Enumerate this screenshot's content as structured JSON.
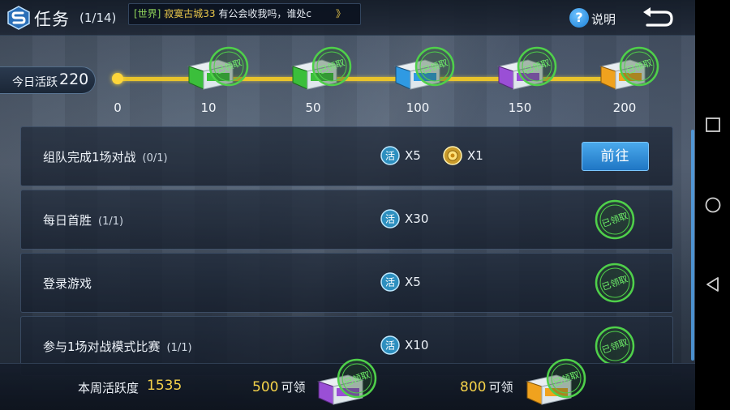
{
  "header": {
    "title": "任务",
    "count": "(1/14)",
    "chat": {
      "channel": "[世界]",
      "name": "寂寞古城33",
      "message": "有公会收我吗，谁处c",
      "arrow": "》"
    },
    "help_icon": "?",
    "help_label": "说明"
  },
  "activity": {
    "today_label": "今日活跃",
    "today_value": "220",
    "milestones": [
      {
        "value": "0"
      },
      {
        "value": "10",
        "chest": "green",
        "stamp": "已领取"
      },
      {
        "value": "50",
        "chest": "green",
        "stamp": "已领取"
      },
      {
        "value": "100",
        "chest": "blue",
        "stamp": "已领取"
      },
      {
        "value": "150",
        "chest": "purple",
        "stamp": "已领取"
      },
      {
        "value": "200",
        "chest": "orange",
        "stamp": "已领取"
      }
    ]
  },
  "tasks": [
    {
      "name": "组队完成1场对战",
      "progress": "(0/1)",
      "rewards": [
        {
          "icon": "huo-icon",
          "count": "X5"
        },
        {
          "icon": "sun-coin-icon",
          "count": "X1"
        }
      ],
      "action": "前往"
    },
    {
      "name": "每日首胜",
      "progress": "(1/1)",
      "rewards": [
        {
          "icon": "huo-icon",
          "count": "X30"
        }
      ],
      "stamp": "已领取"
    },
    {
      "name": "登录游戏",
      "progress": "",
      "rewards": [
        {
          "icon": "huo-icon",
          "count": "X5"
        }
      ],
      "stamp": "已领取"
    },
    {
      "name": "参与1场对战模式比赛",
      "progress": "(1/1)",
      "rewards": [
        {
          "icon": "huo-icon",
          "count": "X10"
        }
      ],
      "stamp": "已领取"
    }
  ],
  "reward_icon_glyph": "活",
  "weekly": {
    "label": "本周活跃度",
    "value": "1535",
    "tiers": [
      {
        "num": "500",
        "label": "可领",
        "chest": "purple",
        "stamp": "已领取"
      },
      {
        "num": "800",
        "label": "可领",
        "chest": "orange",
        "stamp": "已领取"
      }
    ]
  },
  "colors": {
    "accent_yellow": "#f4d24a",
    "button_blue": "#1f76c4",
    "stamp_green": "#3fbf3a",
    "chest_green": "#3bbf3b",
    "chest_blue": "#2f9ae3",
    "chest_purple": "#9a4fd6",
    "chest_orange": "#f0a21e"
  }
}
